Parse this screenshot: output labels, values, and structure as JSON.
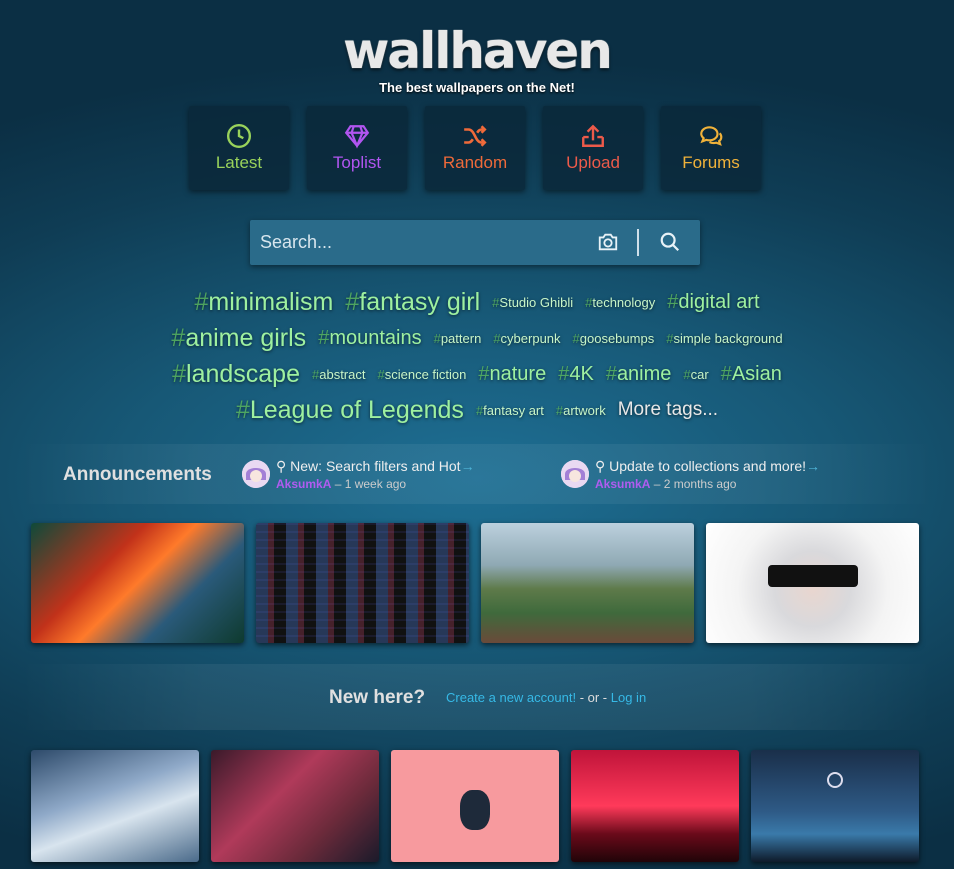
{
  "site": {
    "logo": "wallhaven",
    "tagline": "The best wallpapers on the Net!"
  },
  "nav": [
    {
      "label": "Latest",
      "icon": "clock-icon",
      "color": "#99d25b"
    },
    {
      "label": "Toplist",
      "icon": "diamond-icon",
      "color": "#b155f0"
    },
    {
      "label": "Random",
      "icon": "shuffle-icon",
      "color": "#ef6a3a"
    },
    {
      "label": "Upload",
      "icon": "upload-icon",
      "color": "#ed5a4a"
    },
    {
      "label": "Forums",
      "icon": "chat-icon",
      "color": "#f0b23a"
    }
  ],
  "search": {
    "placeholder": "Search...",
    "camera_icon": "camera-icon",
    "search_icon": "search-icon"
  },
  "tags": {
    "hash": "#",
    "row1": [
      "minimalism",
      "fantasy girl",
      "Studio Ghibli",
      "technology",
      "digital art"
    ],
    "row2": [
      "anime girls",
      "mountains",
      "pattern",
      "cyberpunk",
      "goosebumps",
      "simple background"
    ],
    "row3": [
      "landscape",
      "abstract",
      "science fiction",
      "nature",
      "4K",
      "anime",
      "car",
      "Asian"
    ],
    "row4": [
      "League of Legends",
      "fantasy art",
      "artwork"
    ],
    "more": "More tags..."
  },
  "announcements": {
    "title": "Announcements",
    "items": [
      {
        "text": "New: Search filters and Hot",
        "user": "AksumkA",
        "time": "– 1 week ago"
      },
      {
        "text": "Update to collections and more!",
        "user": "AksumkA",
        "time": "– 2 months ago"
      }
    ]
  },
  "newhere": {
    "title": "New here?",
    "create": "Create a new account!",
    "or": " - or - ",
    "login": "Log in"
  },
  "colors": {
    "accent_link": "#36b9e6",
    "tag_green": "#9ef0a0",
    "username": "#b05cf0"
  }
}
